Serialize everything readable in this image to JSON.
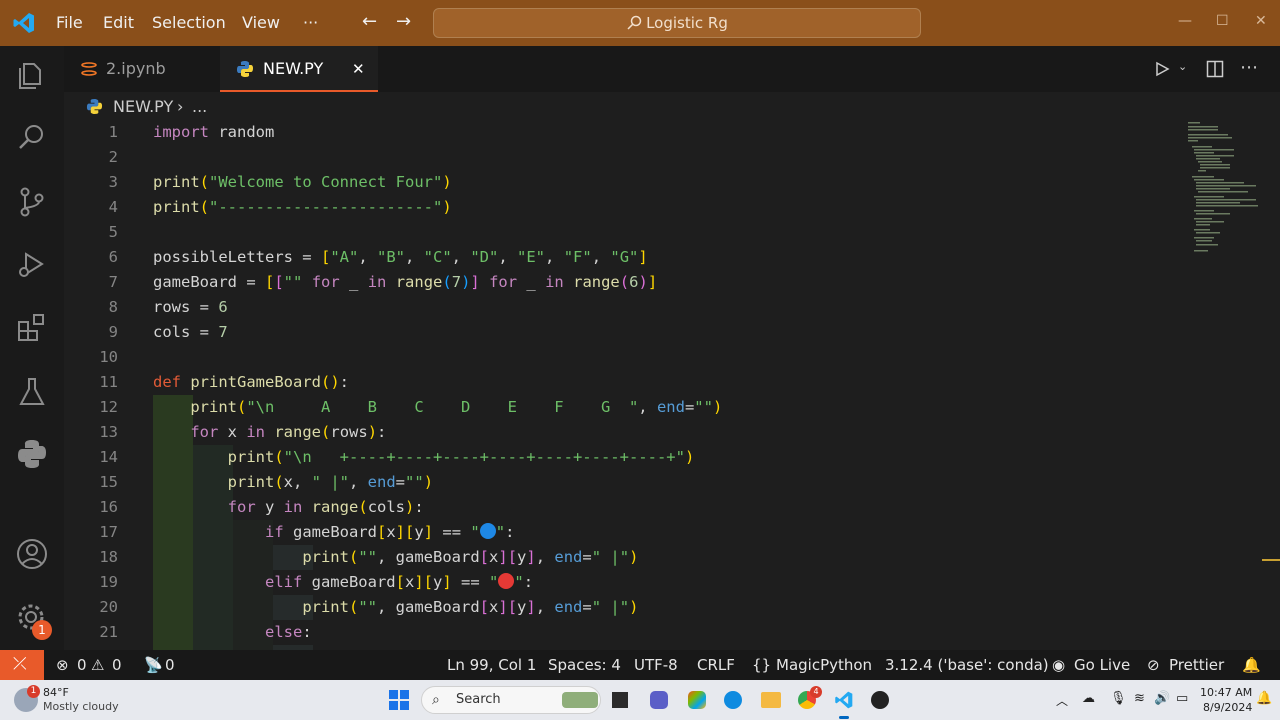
{
  "titlebar": {
    "menus": [
      "File",
      "Edit",
      "Selection",
      "View",
      "···"
    ],
    "search_text": "Logistic Rg"
  },
  "tabs": [
    {
      "label": "2.ipynb",
      "active": false
    },
    {
      "label": "NEW.PY",
      "active": true,
      "close": "✕"
    }
  ],
  "breadcrumb": {
    "file": "NEW.PY",
    "sep": "›",
    "more": "..."
  },
  "code_lines": [
    {
      "n": "1"
    },
    {
      "n": "2"
    },
    {
      "n": "3"
    },
    {
      "n": "4"
    },
    {
      "n": "5"
    },
    {
      "n": "6"
    },
    {
      "n": "7"
    },
    {
      "n": "8"
    },
    {
      "n": "9"
    },
    {
      "n": "10"
    },
    {
      "n": "11"
    },
    {
      "n": "12"
    },
    {
      "n": "13"
    },
    {
      "n": "14"
    },
    {
      "n": "15"
    },
    {
      "n": "16"
    },
    {
      "n": "17"
    },
    {
      "n": "18"
    },
    {
      "n": "19"
    },
    {
      "n": "20"
    },
    {
      "n": "21"
    }
  ],
  "statusbar": {
    "remote_icon": "remote-icon",
    "errors": "0",
    "warnings": "0",
    "ports": "0",
    "position": "Ln 99, Col 1",
    "spaces": "Spaces: 4",
    "encoding": "UTF-8",
    "eol": "CRLF",
    "language": "MagicPython",
    "interpreter": "3.12.4 ('base': conda)",
    "golive": "Go Live",
    "prettier": "Prettier",
    "settings_badge": "1"
  },
  "taskbar": {
    "weather_temp": "84°F",
    "weather_desc": "Mostly cloudy",
    "weather_badge": "1",
    "search_label": "Search",
    "time": "10:47 AM",
    "date": "8/9/2024",
    "chrome_badge": "4"
  },
  "colors": {
    "titlebar": "#8a4f1a",
    "accent": "#e85a2a",
    "editor_bg": "#1e1e1e"
  }
}
